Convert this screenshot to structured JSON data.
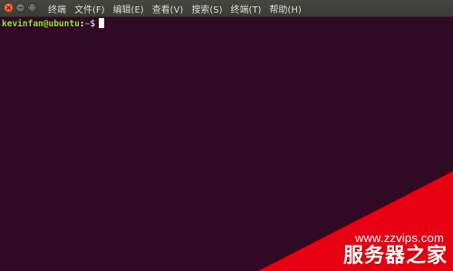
{
  "menu": {
    "items": [
      "终端",
      "文件(F)",
      "编辑(E)",
      "查看(V)",
      "搜索(S)",
      "终端(T)",
      "帮助(H)"
    ]
  },
  "window_buttons": {
    "close_glyph": "×",
    "minimize_glyph": "−",
    "maximize_glyph": "□"
  },
  "terminal": {
    "user_host": "kevinfan@ubuntu",
    "separator": ":",
    "path": "~",
    "prompt_char": "$"
  },
  "watermark": {
    "url": "www.zzvips.com",
    "name": "服务器之家"
  },
  "colors": {
    "terminal_bg": "#300a24",
    "titlebar_bg": "#3c3b37",
    "prompt_user": "#8ae234",
    "prompt_path": "#729fcf",
    "watermark_red": "#e60012"
  }
}
